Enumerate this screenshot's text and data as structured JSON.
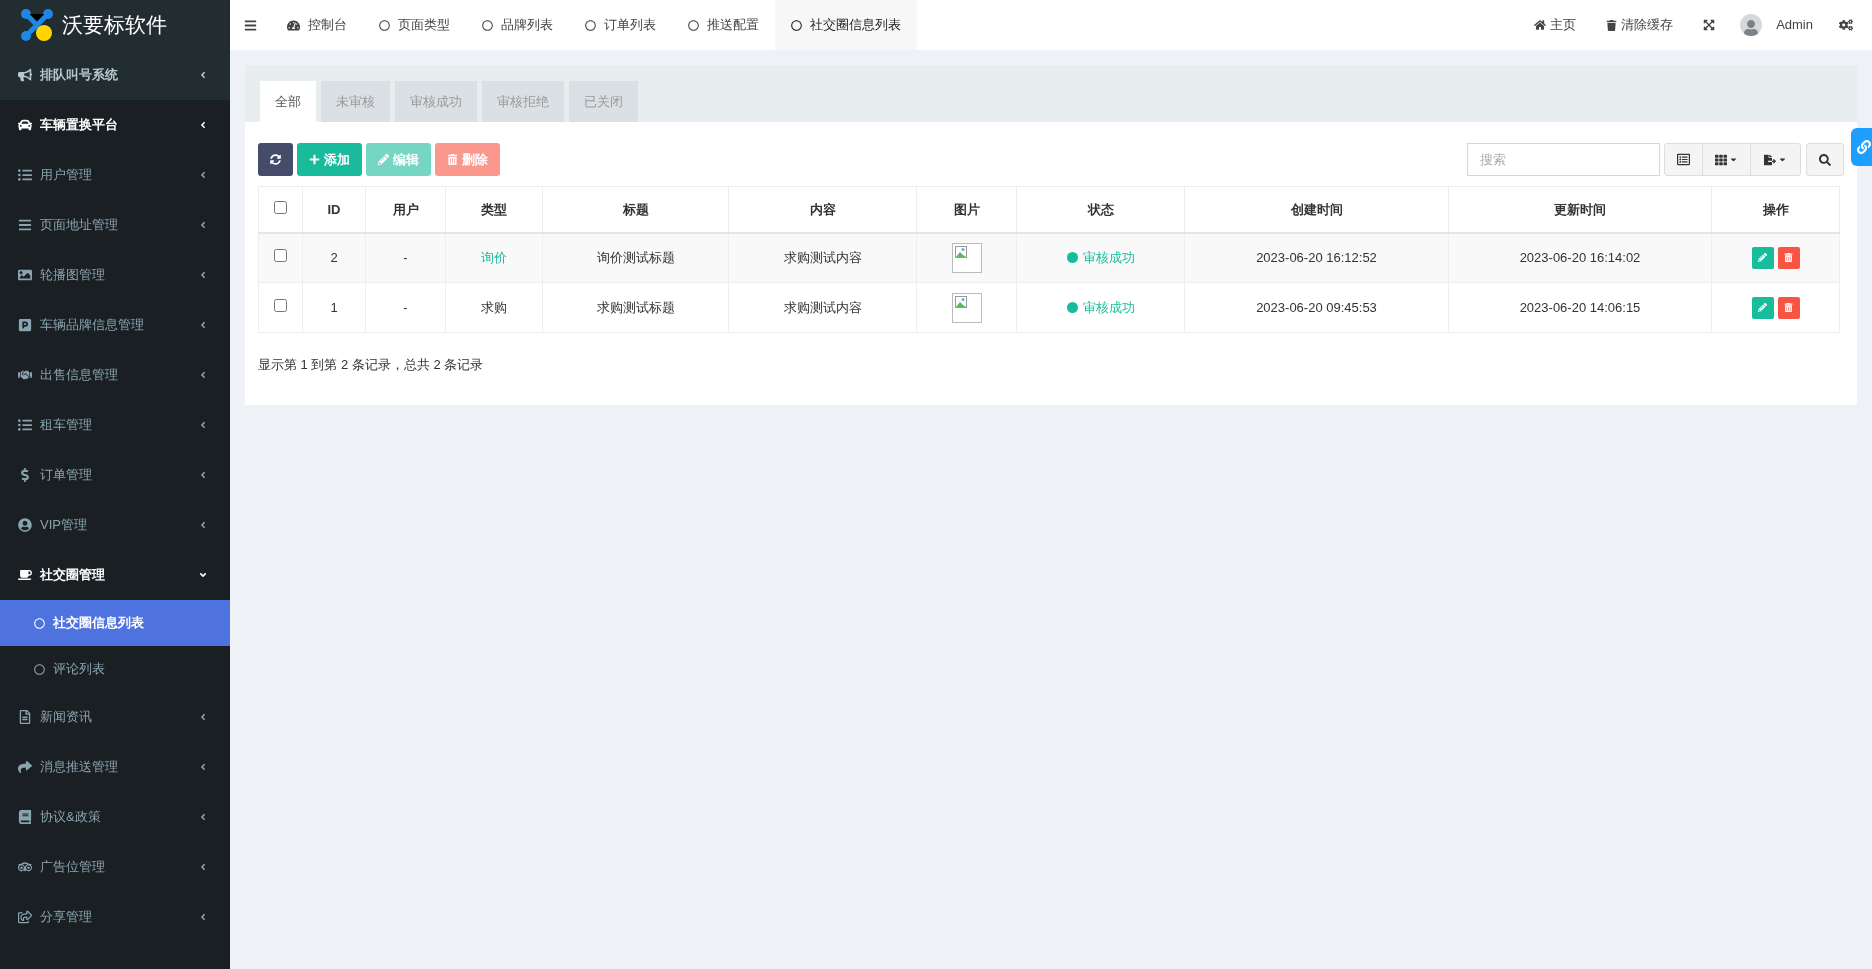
{
  "logo": {
    "text": "沃要标软件"
  },
  "sidebar": {
    "items": [
      {
        "kind": "section",
        "label": "排队叫号系统",
        "expanded": false
      },
      {
        "kind": "section",
        "label": "车辆置换平台",
        "expanded": false
      },
      {
        "kind": "item",
        "label": "用户管理",
        "expanded": false
      },
      {
        "kind": "item",
        "label": "页面地址管理",
        "expanded": false
      },
      {
        "kind": "item",
        "label": "轮播图管理",
        "expanded": false
      },
      {
        "kind": "item",
        "label": "车辆品牌信息管理",
        "expanded": false
      },
      {
        "kind": "item",
        "label": "出售信息管理",
        "expanded": false
      },
      {
        "kind": "item",
        "label": "租车管理",
        "expanded": false
      },
      {
        "kind": "item",
        "label": "订单管理",
        "expanded": false
      },
      {
        "kind": "item",
        "label": "VIP管理",
        "expanded": false
      },
      {
        "kind": "item",
        "label": "社交圈管理",
        "expanded": true,
        "children": [
          {
            "label": "社交圈信息列表",
            "selected": true
          },
          {
            "label": "评论列表",
            "selected": false
          }
        ]
      },
      {
        "kind": "item",
        "label": "新闻资讯",
        "expanded": false
      },
      {
        "kind": "item",
        "label": "消息推送管理",
        "expanded": false
      },
      {
        "kind": "item",
        "label": "协议&政策",
        "expanded": false
      },
      {
        "kind": "item",
        "label": "广告位管理",
        "expanded": false
      },
      {
        "kind": "item",
        "label": "分享管理",
        "expanded": false
      }
    ]
  },
  "top_tabs": [
    {
      "label": "控制台",
      "selected": false
    },
    {
      "label": "页面类型",
      "selected": false
    },
    {
      "label": "品牌列表",
      "selected": false
    },
    {
      "label": "订单列表",
      "selected": false
    },
    {
      "label": "推送配置",
      "selected": false
    },
    {
      "label": "社交圈信息列表",
      "selected": true
    }
  ],
  "top_right": {
    "home": "主页",
    "clear_cache": "清除缓存",
    "user": "Admin"
  },
  "filter_tabs": [
    {
      "label": "全部",
      "selected": true
    },
    {
      "label": "未审核",
      "selected": false
    },
    {
      "label": "审核成功",
      "selected": false
    },
    {
      "label": "审核拒绝",
      "selected": false
    },
    {
      "label": "已关闭",
      "selected": false
    }
  ],
  "toolbar": {
    "buttons": [
      {
        "kind": "refresh",
        "disabled": false
      },
      {
        "kind": "add",
        "label": "添加",
        "disabled": false
      },
      {
        "kind": "edit",
        "label": "编辑",
        "disabled": true
      },
      {
        "kind": "delete",
        "label": "删除",
        "disabled": true
      }
    ],
    "search": {
      "placeholder": "搜索"
    }
  },
  "table": {
    "columns": [
      "ID",
      "用户",
      "类型",
      "标题",
      "内容",
      "图片",
      "状态",
      "创建时间",
      "更新时间",
      "操作"
    ],
    "header_checked": false,
    "rows": [
      {
        "checked": false,
        "id": "2",
        "user": "-",
        "type": {
          "text": "询价",
          "color": "#18bc9c"
        },
        "title": "询价测试标题",
        "content": "求购测试内容",
        "status": {
          "text": "审核成功",
          "color": "#18bc9c"
        },
        "created": "2023-06-20 16:12:52",
        "updated": "2023-06-20 16:14:02"
      },
      {
        "checked": false,
        "id": "1",
        "user": "-",
        "type": {
          "text": "求购",
          "color": "#333333"
        },
        "title": "求购测试标题",
        "content": "求购测试内容",
        "status": {
          "text": "审核成功",
          "color": "#18bc9c"
        },
        "created": "2023-06-20 09:45:53",
        "updated": "2023-06-20 14:06:15"
      }
    ]
  },
  "pagination": {
    "summary": "显示第 1 到第 2 条记录，总共 2 条记录"
  }
}
